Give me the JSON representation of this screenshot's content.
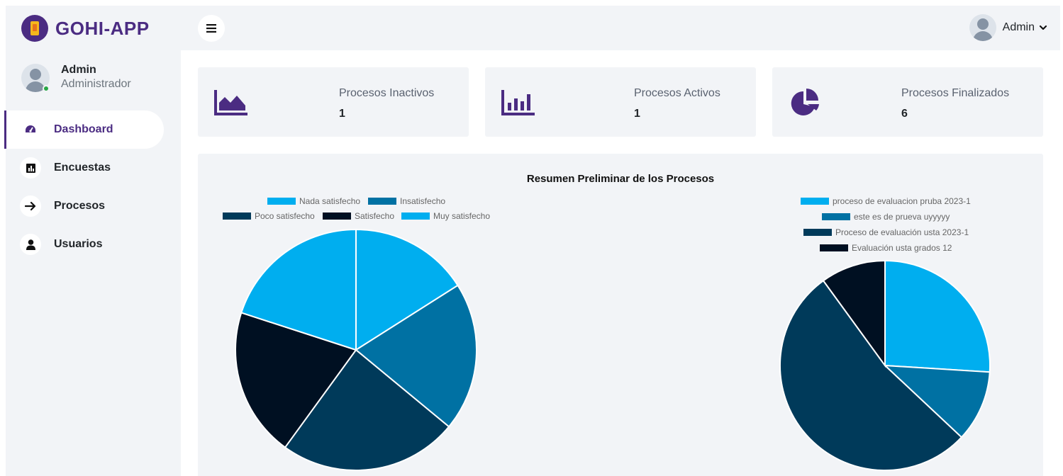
{
  "brand": {
    "name": "GOHI-APP"
  },
  "sidebar": {
    "user": {
      "name": "Admin",
      "role": "Administrador"
    },
    "items": [
      {
        "label": "Dashboard",
        "icon": "gauge-icon",
        "active": true
      },
      {
        "label": "Encuestas",
        "icon": "bar-chart-icon",
        "active": false
      },
      {
        "label": "Procesos",
        "icon": "arrow-right-icon",
        "active": false
      },
      {
        "label": "Usuarios",
        "icon": "user-icon",
        "active": false
      }
    ]
  },
  "topbar": {
    "user_name": "Admin"
  },
  "stats": [
    {
      "title": "Procesos Inactivos",
      "value": "1",
      "icon": "area-chart-icon"
    },
    {
      "title": "Procesos Activos",
      "value": "1",
      "icon": "bar-chart-icon"
    },
    {
      "title": "Procesos Finalizados",
      "value": "6",
      "icon": "pie-chart-icon"
    }
  ],
  "colors": {
    "brand": "#4b2c82",
    "series": [
      "#00aeef",
      "#0071a3",
      "#003a5a",
      "#001022",
      "#00aeef"
    ]
  },
  "chart_data": [
    {
      "type": "pie",
      "title": "Resumen Preliminar de los Procesos",
      "legend_position": "top",
      "labels": [
        "Nada satisfecho",
        "Insatisfecho",
        "Poco satisfecho",
        "Satisfecho",
        "Muy satisfecho"
      ],
      "values": [
        16,
        20,
        24,
        20,
        20
      ],
      "colors": [
        "#00aeef",
        "#0071a3",
        "#003a5a",
        "#001022",
        "#00aeef"
      ]
    },
    {
      "type": "pie",
      "title": "",
      "legend_position": "top",
      "labels": [
        "proceso de evaluacion pruba 2023-1",
        "este es de prueva uyyyyy",
        "Proceso de evaluación usta 2023-1",
        "Evaluación usta grados 12"
      ],
      "values": [
        26,
        11,
        53,
        10
      ],
      "colors": [
        "#00aeef",
        "#0071a3",
        "#003a5a",
        "#001022"
      ]
    }
  ]
}
